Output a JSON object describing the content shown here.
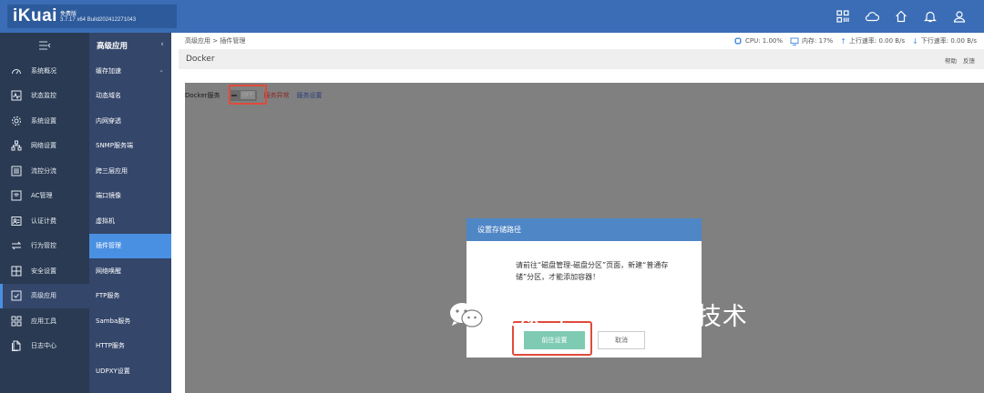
{
  "app": {
    "logo_text": "iKuai",
    "edition": "免费版",
    "version": "3.7.17 x64 Build202412271043"
  },
  "topbar_icons": [
    "grid-icon",
    "cloud-icon",
    "home-icon",
    "bell-icon",
    "user-icon"
  ],
  "sidebar": {
    "collapse_icon": "≡‹",
    "items": [
      {
        "label": "系统概况",
        "icon": "dashboard-icon"
      },
      {
        "label": "状态监控",
        "icon": "monitor-icon"
      },
      {
        "label": "系统设置",
        "icon": "gear-icon"
      },
      {
        "label": "网络设置",
        "icon": "network-icon"
      },
      {
        "label": "流控分流",
        "icon": "flow-control-icon"
      },
      {
        "label": "AC管理",
        "icon": "ac-icon"
      },
      {
        "label": "认证计费",
        "icon": "auth-icon"
      },
      {
        "label": "行为管控",
        "icon": "behavior-icon"
      },
      {
        "label": "安全设置",
        "icon": "security-icon"
      },
      {
        "label": "高级应用",
        "icon": "advanced-icon",
        "active": true
      },
      {
        "label": "应用工具",
        "icon": "tools-icon"
      },
      {
        "label": "日志中心",
        "icon": "log-icon"
      }
    ]
  },
  "subnav": {
    "title": "高级应用",
    "items": [
      {
        "label": "缓存加速",
        "has_chevron": true
      },
      {
        "label": "动态域名"
      },
      {
        "label": "内网穿透"
      },
      {
        "label": "SNMP服务端"
      },
      {
        "label": "跨三层应用"
      },
      {
        "label": "端口镜像"
      },
      {
        "label": "虚拟机"
      },
      {
        "label": "插件管理",
        "active": true
      },
      {
        "label": "网络唤醒"
      },
      {
        "label": "FTP服务"
      },
      {
        "label": "Samba服务"
      },
      {
        "label": "HTTP服务"
      },
      {
        "label": "UDPXY设置"
      }
    ]
  },
  "breadcrumb": "高级应用 > 插件管理",
  "stats": {
    "cpu": "CPU: 1.00%",
    "mem": "内存: 17%",
    "up": "上行速率: 0.00 B/s",
    "down": "下行速率: 0.00 B/s"
  },
  "page": {
    "title": "Docker",
    "help": "帮助",
    "feedback": "反馈"
  },
  "service": {
    "label": "Docker服务",
    "toggle_state": "OFF",
    "error": "服务异常",
    "settings": "服务设置"
  },
  "modal": {
    "title": "设置存储路径",
    "message": "请前往“磁盘管理-磁盘分区”页面，新建“普通存储”分区，才能添加容器！",
    "confirm": "前往设置",
    "cancel": "取消"
  },
  "watermark": "公众号 · 小白电脑技术",
  "colors": {
    "topbar": "#3a6db5",
    "sidebar": "#2a3a52",
    "subnav": "#34466a",
    "active": "#4a90e2",
    "modal_head": "#4f86c6",
    "confirm_btn": "#7fcab3",
    "highlight": "#e04a3a"
  }
}
